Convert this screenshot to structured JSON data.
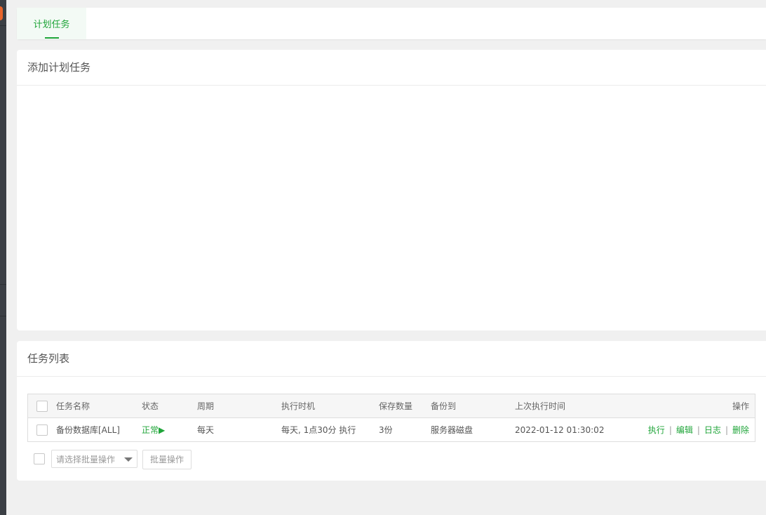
{
  "tabs": [
    {
      "label": "计划任务",
      "active": true
    }
  ],
  "add_section": {
    "title": "添加计划任务"
  },
  "list_section": {
    "title": "任务列表",
    "columns": [
      "任务名称",
      "状态",
      "周期",
      "执行时机",
      "保存数量",
      "备份到",
      "上次执行时间",
      "操作"
    ],
    "rows": [
      {
        "name": "备份数据库[ALL]",
        "status": "正常▶",
        "cycle": "每天",
        "exec_time": "每天, 1点30分 执行",
        "keep": "3份",
        "backup_to": "服务器磁盘",
        "last_run": "2022-01-12 01:30:02",
        "actions": [
          "执行",
          "编辑",
          "日志",
          "删除"
        ]
      }
    ]
  },
  "batch": {
    "select_placeholder": "请选择批量操作",
    "button_label": "批量操作"
  },
  "colors": {
    "accent": "#20a53a",
    "background": "#f0f0f0",
    "sidebar": "#3b3f45",
    "badge": "#e8642b"
  }
}
